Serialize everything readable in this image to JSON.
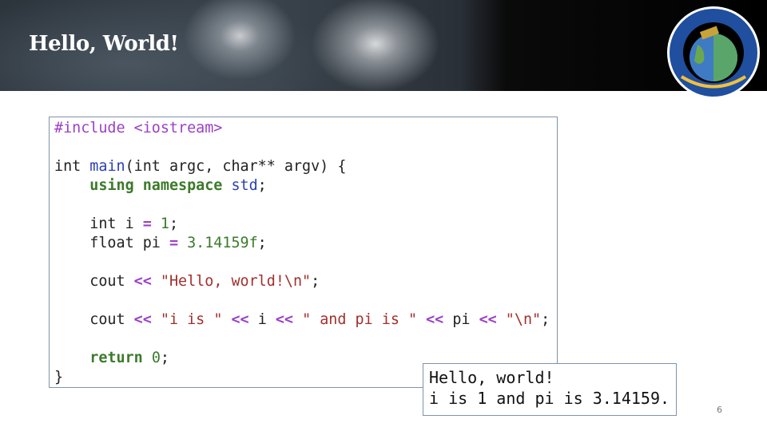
{
  "slide": {
    "title": "Hello, World!",
    "page_number": "6"
  },
  "logo": {
    "ring_text": "JOINT CENTER FOR SATELLITE DATA ASSIMILATION",
    "bottom_text": "NOAA NASA JCSDA Navy Air Force"
  },
  "code_lines": [
    [
      {
        "t": "#include <iostream>",
        "c": "kw"
      }
    ],
    [],
    [
      {
        "t": "int ",
        "c": "pl"
      },
      {
        "t": "main",
        "c": "fn"
      },
      {
        "t": "(int argc, char** argv) {",
        "c": "pl"
      }
    ],
    [
      {
        "t": "    ",
        "c": "pl"
      },
      {
        "t": "using namespace ",
        "c": "kw2"
      },
      {
        "t": "std",
        "c": "fn"
      },
      {
        "t": ";",
        "c": "pl"
      }
    ],
    [],
    [
      {
        "t": "    int i ",
        "c": "pl"
      },
      {
        "t": "=",
        "c": "op"
      },
      {
        "t": " ",
        "c": "pl"
      },
      {
        "t": "1",
        "c": "num"
      },
      {
        "t": ";",
        "c": "pl"
      }
    ],
    [
      {
        "t": "    float pi ",
        "c": "pl"
      },
      {
        "t": "=",
        "c": "op"
      },
      {
        "t": " ",
        "c": "pl"
      },
      {
        "t": "3.14159f",
        "c": "num"
      },
      {
        "t": ";",
        "c": "pl"
      }
    ],
    [],
    [
      {
        "t": "    cout ",
        "c": "pl"
      },
      {
        "t": "<<",
        "c": "op"
      },
      {
        "t": " ",
        "c": "pl"
      },
      {
        "t": "\"Hello, world!\\n\"",
        "c": "str"
      },
      {
        "t": ";",
        "c": "pl"
      }
    ],
    [],
    [
      {
        "t": "    cout ",
        "c": "pl"
      },
      {
        "t": "<<",
        "c": "op"
      },
      {
        "t": " ",
        "c": "pl"
      },
      {
        "t": "\"i is \"",
        "c": "str"
      },
      {
        "t": " ",
        "c": "pl"
      },
      {
        "t": "<<",
        "c": "op"
      },
      {
        "t": " i ",
        "c": "pl"
      },
      {
        "t": "<<",
        "c": "op"
      },
      {
        "t": " ",
        "c": "pl"
      },
      {
        "t": "\" and pi is \"",
        "c": "str"
      },
      {
        "t": " ",
        "c": "pl"
      },
      {
        "t": "<<",
        "c": "op"
      },
      {
        "t": " pi ",
        "c": "pl"
      },
      {
        "t": "<<",
        "c": "op"
      },
      {
        "t": " ",
        "c": "pl"
      },
      {
        "t": "\"\\n\"",
        "c": "str"
      },
      {
        "t": ";",
        "c": "pl"
      }
    ],
    [],
    [
      {
        "t": "    ",
        "c": "pl"
      },
      {
        "t": "return",
        "c": "kw2"
      },
      {
        "t": " ",
        "c": "pl"
      },
      {
        "t": "0",
        "c": "num"
      },
      {
        "t": ";",
        "c": "pl"
      }
    ],
    [
      {
        "t": "}",
        "c": "pl"
      }
    ]
  ],
  "output": {
    "lines": [
      "Hello, world!",
      "i is 1 and pi is 3.14159."
    ]
  },
  "colors": {
    "keyword": "#9b3fc8",
    "function": "#2b41b5",
    "type_keyword": "#3b7a2a",
    "string": "#a2302b",
    "border": "#7f93a6"
  }
}
